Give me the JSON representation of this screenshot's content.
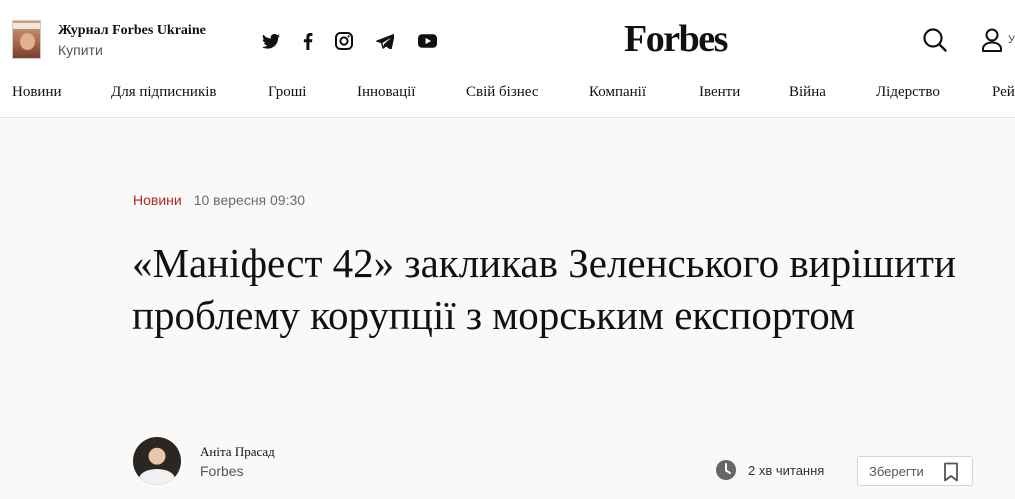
{
  "header": {
    "magazine_title": "Журнал Forbes Ukraine",
    "buy_label": "Купити",
    "logo_text": "Forbes",
    "user_label": "У",
    "social_icons": [
      "twitter-icon",
      "facebook-icon",
      "instagram-icon",
      "telegram-icon",
      "youtube-icon"
    ]
  },
  "nav": {
    "items": [
      "Новини",
      "Для підписників",
      "Гроші",
      "Інновації",
      "Свій бізнес",
      "Компанії",
      "Івенти",
      "Війна",
      "Лідерство",
      "Рей"
    ]
  },
  "article": {
    "category": "Новини",
    "date": "10 вересня 09:30",
    "headline": "«Маніфест 42» закликав Зеленського вирішити проблему корупції з морським експортом",
    "author_name": "Аніта Прасад",
    "author_org": "Forbes",
    "read_time": "2 хв читання",
    "save_label": "Зберегти"
  },
  "colors": {
    "category": "#b22a2a",
    "article_background": "#f9f9f9",
    "text": "#111111"
  }
}
